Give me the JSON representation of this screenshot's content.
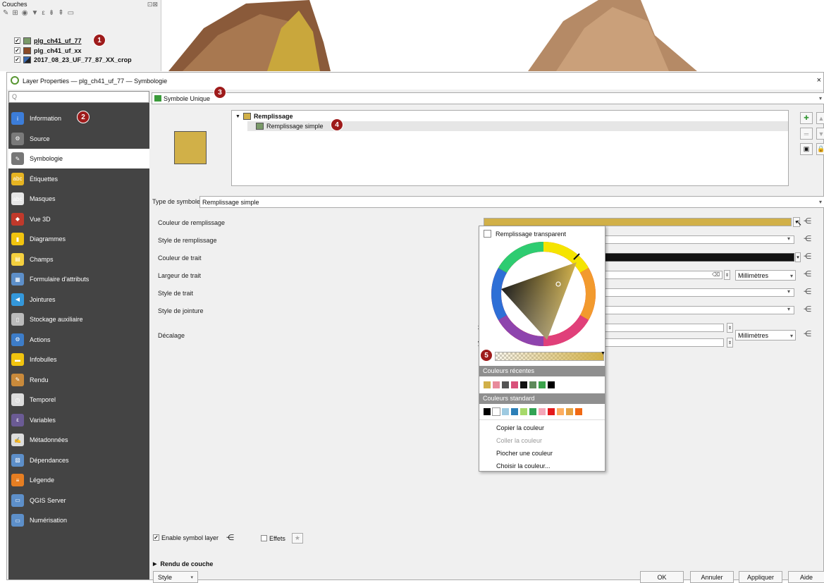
{
  "layers_panel": {
    "title": "Couches",
    "dock_buttons": "⊡⊠",
    "layers": [
      {
        "name": "plg_ch41_uf_77",
        "checked": "✓",
        "color": "#7a9a69"
      },
      {
        "name": "plg_ch41_uf_xx",
        "checked": "✓",
        "color": "#8a4a26"
      },
      {
        "name": "2017_08_23_UF_77_87_XX_crop",
        "checked": "✓",
        "color": "#3a6ab0"
      }
    ]
  },
  "badges": [
    "1",
    "2",
    "3",
    "4",
    "5"
  ],
  "dialog": {
    "title": "Layer Properties — plg_ch41_uf_77 — Symbologie",
    "close": "×",
    "search_placeholder": "Q",
    "nav": [
      {
        "label": "Information",
        "icon": "info-icon",
        "color": "#3c7dd9"
      },
      {
        "label": "Source",
        "icon": "source-icon",
        "color": "#7a7a7a"
      },
      {
        "label": "Symbologie",
        "icon": "brush-icon",
        "color": "#777"
      },
      {
        "label": "Étiquettes",
        "icon": "labels-icon",
        "color": "#e6b422"
      },
      {
        "label": "Masques",
        "icon": "mask-icon",
        "color": "#e6e6e6"
      },
      {
        "label": "Vue 3D",
        "icon": "cube-icon",
        "color": "#c0392b"
      },
      {
        "label": "Diagrammes",
        "icon": "diagram-icon",
        "color": "#f1c40f"
      },
      {
        "label": "Champs",
        "icon": "fields-icon",
        "color": "#f4d03f"
      },
      {
        "label": "Formulaire d'attributs",
        "icon": "form-icon",
        "color": "#5d8fc9"
      },
      {
        "label": "Jointures",
        "icon": "join-icon",
        "color": "#3498db"
      },
      {
        "label": "Stockage auxiliaire",
        "icon": "storage-icon",
        "color": "#bbb"
      },
      {
        "label": "Actions",
        "icon": "actions-icon",
        "color": "#3d7dc9"
      },
      {
        "label": "Infobulles",
        "icon": "tooltip-icon",
        "color": "#f1c40f"
      },
      {
        "label": "Rendu",
        "icon": "render-icon",
        "color": "#c98a3b"
      },
      {
        "label": "Temporel",
        "icon": "clock-icon",
        "color": "#ddd"
      },
      {
        "label": "Variables",
        "icon": "variables-icon",
        "color": "#6b5b95"
      },
      {
        "label": "Métadonnées",
        "icon": "metadata-icon",
        "color": "#ddd"
      },
      {
        "label": "Dépendances",
        "icon": "dependencies-icon",
        "color": "#5d8fc9"
      },
      {
        "label": "Légende",
        "icon": "legend-icon",
        "color": "#e67e22"
      },
      {
        "label": "QGIS Server",
        "icon": "server-icon",
        "color": "#5d8fc9"
      },
      {
        "label": "Numérisation",
        "icon": "digitize-icon",
        "color": "#5d8fc9"
      }
    ],
    "renderer": "Symbole Unique",
    "tree": {
      "parent": "Remplissage",
      "child": "Remplissage simple"
    },
    "symbol_type_label": "Type de symbole",
    "symbol_type_value": "Remplissage simple",
    "props": [
      "Couleur de remplissage",
      "Style de remplissage",
      "Couleur de trait",
      "Largeur de trait",
      "Style de trait",
      "Style de jointure",
      "Décalage"
    ],
    "units": [
      "Millimètres",
      "Millimètres"
    ],
    "offset_axes": [
      "x",
      "y"
    ],
    "fill_color": "#d1b048",
    "enable_symbol_layer": "Enable symbol layer",
    "effects": "Effets",
    "layer_rendering": "Rendu de couche",
    "style_button": "Style",
    "buttons": [
      "OK",
      "Annuler",
      "Appliquer",
      "Aide"
    ]
  },
  "color_popup": {
    "transparent": "Remplissage transparent",
    "recent_title": "Couleurs récentes",
    "recent": [
      "#d1b048",
      "#e88a9a",
      "#555555",
      "#d9507a",
      "#111111",
      "#5e8a5a",
      "#3aa34a",
      "#000000"
    ],
    "standard_title": "Couleurs standard",
    "standard": [
      "#000000",
      "#ffffff",
      "#9ecae1",
      "#2c7fb8",
      "#a6d96a",
      "#31a354",
      "#f4a6b8",
      "#e31a1c",
      "#fdae61",
      "#e6a243",
      "#f16913"
    ],
    "menu": [
      "Copier la couleur",
      "Coller la couleur",
      "Piocher une couleur",
      "Choisir la couleur..."
    ]
  }
}
